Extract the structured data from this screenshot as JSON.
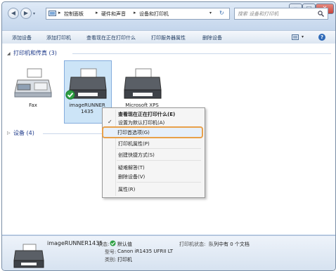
{
  "titlebar": {
    "back_glyph": "◀",
    "forward_glyph": "▶",
    "breadcrumb": [
      "控制面板",
      "硬件和声音",
      "设备和打印机"
    ],
    "search_placeholder": "搜索 设备和打印机",
    "min_glyph": "─",
    "max_glyph": "□",
    "close_glyph": "✕",
    "close_color": "#c7433a"
  },
  "toolbar": {
    "add_device": "添加设备",
    "add_printer": "添加打印机",
    "see_whats_printing": "查看现在正在打印什么",
    "print_server_props": "打印服务器属性",
    "remove_device": "删除设备",
    "help_glyph": "?"
  },
  "groups": {
    "printers_title": "打印机和传真 (3)",
    "devices_title": "设备 (4)"
  },
  "printers": [
    {
      "name": "Fax"
    },
    {
      "name_line1": "imageRUNNER",
      "name_line2": "1435"
    },
    {
      "name": "Microsoft XPS"
    }
  ],
  "context_menu": {
    "items": [
      {
        "label": "查看现在正在打印什么(E)",
        "bold": true
      },
      {
        "label": "设置为默认打印机(A)",
        "checked": true
      },
      {
        "label": "打印首选项(G)",
        "highlighted": true
      },
      {
        "label": "打印机属性(P)"
      },
      {
        "label": "创建快捷方式(S)"
      },
      {
        "label": "疑难解答(T)"
      },
      {
        "label": "删除设备(V)"
      },
      {
        "label": "属性(R)"
      }
    ],
    "check_glyph": "✓",
    "highlight_color": "#e8a04a"
  },
  "details": {
    "device_name": "imageRUNNER1435",
    "status_label": "状态:",
    "status_value": "默认值",
    "printer_status_label": "打印机状态:",
    "printer_status_value": "队列中有 0 个文档",
    "model_label": "型号:",
    "model_value": "Canon iR1435 UFRII LT",
    "category_label": "类别:",
    "category_value": "打印机"
  },
  "colors": {
    "accent": "#1e3a8a",
    "default_badge": "#2ea043",
    "selection": "#cce4f7"
  }
}
